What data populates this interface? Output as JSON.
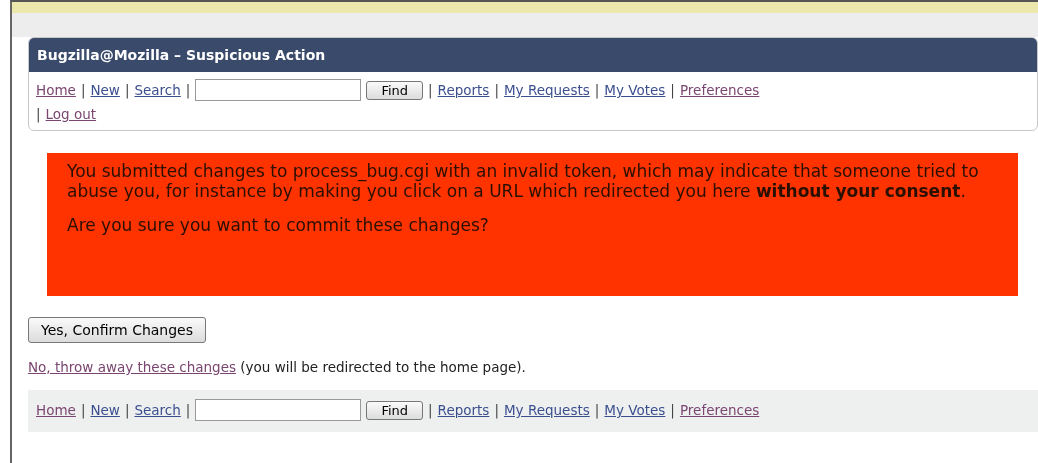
{
  "header": {
    "title": "Bugzilla@Mozilla – Suspicious Action",
    "nav_lines": [
      [
        {
          "kind": "link",
          "text": "Home",
          "visited": true
        },
        {
          "kind": "sep",
          "text": "|"
        },
        {
          "kind": "link",
          "text": "New",
          "visited": false
        },
        {
          "kind": "sep",
          "text": "|"
        },
        {
          "kind": "link",
          "text": "Search",
          "visited": false
        },
        {
          "kind": "sep",
          "text": "|"
        },
        {
          "kind": "search"
        },
        {
          "kind": "button",
          "text": "Find"
        },
        {
          "kind": "sep",
          "text": "|"
        },
        {
          "kind": "link",
          "text": "Reports",
          "visited": false
        },
        {
          "kind": "sep",
          "text": "|"
        },
        {
          "kind": "link",
          "text": "My Requests",
          "visited": false
        },
        {
          "kind": "sep",
          "text": "|"
        },
        {
          "kind": "link",
          "text": "My Votes",
          "visited": false
        },
        {
          "kind": "sep",
          "text": "|"
        },
        {
          "kind": "link",
          "text": "Preferences",
          "visited": true
        }
      ],
      [
        {
          "kind": "sep",
          "text": "|"
        },
        {
          "kind": "link",
          "text": "Log out",
          "visited": true
        }
      ]
    ]
  },
  "warning": {
    "paragraphs": [
      "You submitted changes to process_bug.cgi with an invalid token, which may indicate that someone tried to abuse you, for instance by making you click on a URL which redirected you here **without your consent**.",
      "Are you sure you want to commit these changes?"
    ]
  },
  "confirm_button": "Yes, Confirm Changes",
  "discard": {
    "link": "No, throw away these changes",
    "note": "(you will be redirected to the home page)."
  },
  "footer": {
    "nav_lines": [
      [
        {
          "kind": "link",
          "text": "Home",
          "visited": true
        },
        {
          "kind": "sep",
          "text": "|"
        },
        {
          "kind": "link",
          "text": "New",
          "visited": false
        },
        {
          "kind": "sep",
          "text": "|"
        },
        {
          "kind": "link",
          "text": "Search",
          "visited": false
        },
        {
          "kind": "sep",
          "text": "|"
        },
        {
          "kind": "search"
        },
        {
          "kind": "button",
          "text": "Find"
        },
        {
          "kind": "sep",
          "text": "|"
        },
        {
          "kind": "link",
          "text": "Reports",
          "visited": false
        },
        {
          "kind": "sep",
          "text": "|"
        },
        {
          "kind": "link",
          "text": "My Requests",
          "visited": false
        },
        {
          "kind": "sep",
          "text": "|"
        },
        {
          "kind": "link",
          "text": "My Votes",
          "visited": false
        },
        {
          "kind": "sep",
          "text": "|"
        },
        {
          "kind": "link",
          "text": "Preferences",
          "visited": true
        }
      ]
    ]
  }
}
